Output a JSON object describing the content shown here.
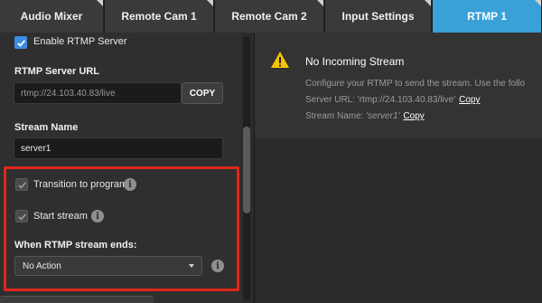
{
  "tabs": [
    {
      "label": "Audio Mixer",
      "active": false
    },
    {
      "label": "Remote Cam 1",
      "active": false
    },
    {
      "label": "Remote Cam 2",
      "active": false
    },
    {
      "label": "Input Settings",
      "active": false
    },
    {
      "label": "RTMP 1",
      "active": true
    }
  ],
  "left": {
    "enable_server": {
      "label": "Enable RTMP Server",
      "checked": true
    },
    "server_url": {
      "label": "RTMP Server URL",
      "value": "rtmp://24.103.40.83/live",
      "copy_label": "COPY"
    },
    "stream_name": {
      "label": "Stream Name",
      "value": "server1"
    },
    "transition": {
      "label": "Transition to program",
      "checked": true
    },
    "start_stream": {
      "label": "Start stream",
      "checked": true
    },
    "stream_ends": {
      "label": "When RTMP stream ends:",
      "selected": "No Action"
    },
    "info_glyph": "i"
  },
  "notice": {
    "title": "No Incoming Stream",
    "line1": "Configure your RTMP to send the stream. Use the follo",
    "line2_prefix": "Server URL: 'rtmp://24.103.40.83/live'",
    "line2_link": "Copy",
    "line3_prefix": "Stream Name: ",
    "line3_value": "'server1'",
    "line3_link": "Copy",
    "icon": "warning-icon"
  },
  "colors": {
    "accent": "#3aa0d8",
    "checkbox": "#3d8de0",
    "highlight": "#e0261a",
    "warning": "#f5c400"
  }
}
